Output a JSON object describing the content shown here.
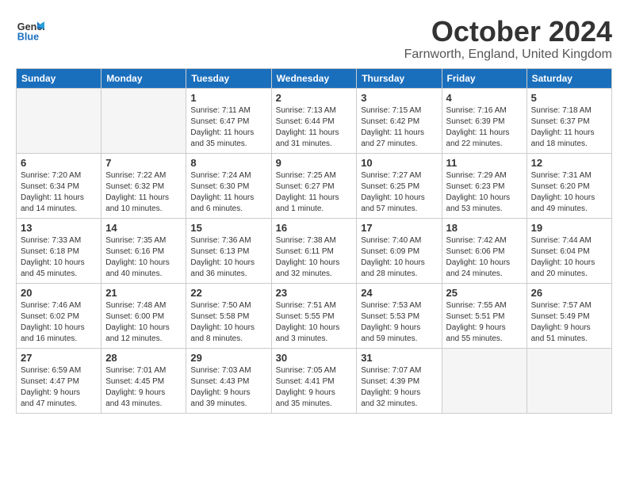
{
  "header": {
    "logo_text_general": "General",
    "logo_text_blue": "Blue",
    "month_title": "October 2024",
    "location": "Farnworth, England, United Kingdom"
  },
  "weekdays": [
    "Sunday",
    "Monday",
    "Tuesday",
    "Wednesday",
    "Thursday",
    "Friday",
    "Saturday"
  ],
  "weeks": [
    [
      {
        "num": "",
        "info": ""
      },
      {
        "num": "",
        "info": ""
      },
      {
        "num": "1",
        "info": "Sunrise: 7:11 AM\nSunset: 6:47 PM\nDaylight: 11 hours\nand 35 minutes."
      },
      {
        "num": "2",
        "info": "Sunrise: 7:13 AM\nSunset: 6:44 PM\nDaylight: 11 hours\nand 31 minutes."
      },
      {
        "num": "3",
        "info": "Sunrise: 7:15 AM\nSunset: 6:42 PM\nDaylight: 11 hours\nand 27 minutes."
      },
      {
        "num": "4",
        "info": "Sunrise: 7:16 AM\nSunset: 6:39 PM\nDaylight: 11 hours\nand 22 minutes."
      },
      {
        "num": "5",
        "info": "Sunrise: 7:18 AM\nSunset: 6:37 PM\nDaylight: 11 hours\nand 18 minutes."
      }
    ],
    [
      {
        "num": "6",
        "info": "Sunrise: 7:20 AM\nSunset: 6:34 PM\nDaylight: 11 hours\nand 14 minutes."
      },
      {
        "num": "7",
        "info": "Sunrise: 7:22 AM\nSunset: 6:32 PM\nDaylight: 11 hours\nand 10 minutes."
      },
      {
        "num": "8",
        "info": "Sunrise: 7:24 AM\nSunset: 6:30 PM\nDaylight: 11 hours\nand 6 minutes."
      },
      {
        "num": "9",
        "info": "Sunrise: 7:25 AM\nSunset: 6:27 PM\nDaylight: 11 hours\nand 1 minute."
      },
      {
        "num": "10",
        "info": "Sunrise: 7:27 AM\nSunset: 6:25 PM\nDaylight: 10 hours\nand 57 minutes."
      },
      {
        "num": "11",
        "info": "Sunrise: 7:29 AM\nSunset: 6:23 PM\nDaylight: 10 hours\nand 53 minutes."
      },
      {
        "num": "12",
        "info": "Sunrise: 7:31 AM\nSunset: 6:20 PM\nDaylight: 10 hours\nand 49 minutes."
      }
    ],
    [
      {
        "num": "13",
        "info": "Sunrise: 7:33 AM\nSunset: 6:18 PM\nDaylight: 10 hours\nand 45 minutes."
      },
      {
        "num": "14",
        "info": "Sunrise: 7:35 AM\nSunset: 6:16 PM\nDaylight: 10 hours\nand 40 minutes."
      },
      {
        "num": "15",
        "info": "Sunrise: 7:36 AM\nSunset: 6:13 PM\nDaylight: 10 hours\nand 36 minutes."
      },
      {
        "num": "16",
        "info": "Sunrise: 7:38 AM\nSunset: 6:11 PM\nDaylight: 10 hours\nand 32 minutes."
      },
      {
        "num": "17",
        "info": "Sunrise: 7:40 AM\nSunset: 6:09 PM\nDaylight: 10 hours\nand 28 minutes."
      },
      {
        "num": "18",
        "info": "Sunrise: 7:42 AM\nSunset: 6:06 PM\nDaylight: 10 hours\nand 24 minutes."
      },
      {
        "num": "19",
        "info": "Sunrise: 7:44 AM\nSunset: 6:04 PM\nDaylight: 10 hours\nand 20 minutes."
      }
    ],
    [
      {
        "num": "20",
        "info": "Sunrise: 7:46 AM\nSunset: 6:02 PM\nDaylight: 10 hours\nand 16 minutes."
      },
      {
        "num": "21",
        "info": "Sunrise: 7:48 AM\nSunset: 6:00 PM\nDaylight: 10 hours\nand 12 minutes."
      },
      {
        "num": "22",
        "info": "Sunrise: 7:50 AM\nSunset: 5:58 PM\nDaylight: 10 hours\nand 8 minutes."
      },
      {
        "num": "23",
        "info": "Sunrise: 7:51 AM\nSunset: 5:55 PM\nDaylight: 10 hours\nand 3 minutes."
      },
      {
        "num": "24",
        "info": "Sunrise: 7:53 AM\nSunset: 5:53 PM\nDaylight: 9 hours\nand 59 minutes."
      },
      {
        "num": "25",
        "info": "Sunrise: 7:55 AM\nSunset: 5:51 PM\nDaylight: 9 hours\nand 55 minutes."
      },
      {
        "num": "26",
        "info": "Sunrise: 7:57 AM\nSunset: 5:49 PM\nDaylight: 9 hours\nand 51 minutes."
      }
    ],
    [
      {
        "num": "27",
        "info": "Sunrise: 6:59 AM\nSunset: 4:47 PM\nDaylight: 9 hours\nand 47 minutes."
      },
      {
        "num": "28",
        "info": "Sunrise: 7:01 AM\nSunset: 4:45 PM\nDaylight: 9 hours\nand 43 minutes."
      },
      {
        "num": "29",
        "info": "Sunrise: 7:03 AM\nSunset: 4:43 PM\nDaylight: 9 hours\nand 39 minutes."
      },
      {
        "num": "30",
        "info": "Sunrise: 7:05 AM\nSunset: 4:41 PM\nDaylight: 9 hours\nand 35 minutes."
      },
      {
        "num": "31",
        "info": "Sunrise: 7:07 AM\nSunset: 4:39 PM\nDaylight: 9 hours\nand 32 minutes."
      },
      {
        "num": "",
        "info": ""
      },
      {
        "num": "",
        "info": ""
      }
    ]
  ]
}
